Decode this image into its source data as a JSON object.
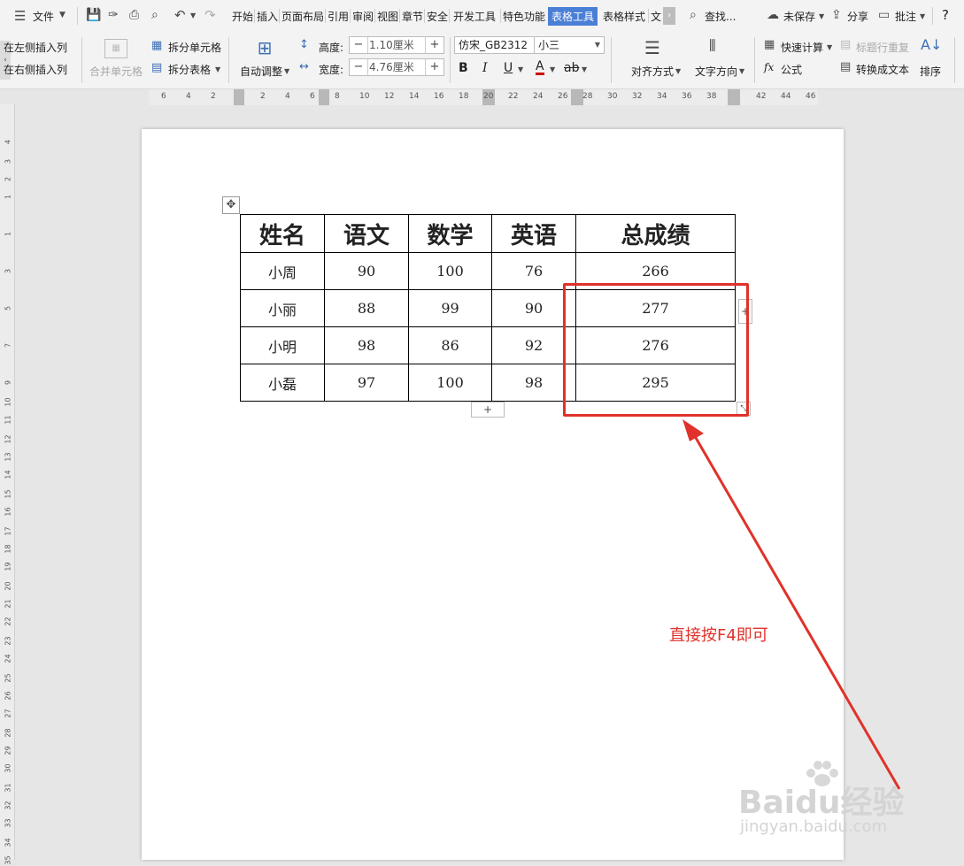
{
  "menubar": {
    "file_label": "文件",
    "tabs": [
      {
        "label": "开始"
      },
      {
        "label": "插入"
      },
      {
        "label": "页面布局"
      },
      {
        "label": "引用"
      },
      {
        "label": "审阅"
      },
      {
        "label": "视图"
      },
      {
        "label": "章节"
      },
      {
        "label": "安全"
      },
      {
        "label": "开发工具"
      },
      {
        "label": "特色功能"
      },
      {
        "label": "表格工具"
      },
      {
        "label": "表格样式"
      },
      {
        "label": "文"
      }
    ],
    "search_label": "查找...",
    "unsaved_label": "未保存",
    "share_label": "分享",
    "comment_label": "批注",
    "help_label": "?"
  },
  "ribbon": {
    "insert_left_col": "在左侧插入列",
    "insert_right_col": "在右侧插入列",
    "merge_cells": "合并单元格",
    "split_cells": "拆分单元格",
    "split_table": "拆分表格",
    "auto_adjust": "自动调整",
    "height_label": "高度:",
    "height_value": "1.10厘米",
    "width_label": "宽度:",
    "width_value": "4.76厘米",
    "font_name": "仿宋_GB2312",
    "font_size": "小三",
    "bold": "B",
    "italic": "I",
    "underline": "U",
    "font_color": "A",
    "highlight": "ab",
    "align_label": "对齐方式",
    "text_dir_label": "文字方向",
    "quick_calc": "快速计算",
    "formula": "公式",
    "repeat_header": "标题行重复",
    "convert_text": "转换成文本",
    "sort": "排序"
  },
  "hruler": {
    "ticks": [
      "6",
      "4",
      "2",
      "2",
      "4",
      "6",
      "8",
      "10",
      "12",
      "14",
      "16",
      "18",
      "20",
      "22",
      "24",
      "26",
      "28",
      "30",
      "32",
      "34",
      "36",
      "38",
      "42",
      "44",
      "46"
    ]
  },
  "vruler": {
    "ticks": [
      "4",
      "3",
      "2",
      "1",
      "1",
      "3",
      "5",
      "7",
      "9",
      "10",
      "11",
      "12",
      "13",
      "14",
      "15",
      "16",
      "17",
      "18",
      "19",
      "20",
      "21",
      "22",
      "23",
      "24",
      "25",
      "26",
      "27",
      "28",
      "29",
      "30",
      "31",
      "32",
      "33",
      "34",
      "35"
    ]
  },
  "table": {
    "headers": [
      "姓名",
      "语文",
      "数学",
      "英语",
      "总成绩"
    ],
    "rows": [
      [
        "小周",
        "90",
        "100",
        "76",
        "266"
      ],
      [
        "小丽",
        "88",
        "99",
        "90",
        "277"
      ],
      [
        "小明",
        "98",
        "86",
        "92",
        "276"
      ],
      [
        "小磊",
        "97",
        "100",
        "98",
        "295"
      ]
    ]
  },
  "annotation": {
    "text": "直接按F4即可",
    "color": "#e0322a"
  },
  "watermark": {
    "brand": "Baidu经验",
    "url": "jingyan.baidu.com"
  },
  "colors": {
    "active_tab": "#4a7fd6",
    "annotation_red": "#e0322a"
  }
}
